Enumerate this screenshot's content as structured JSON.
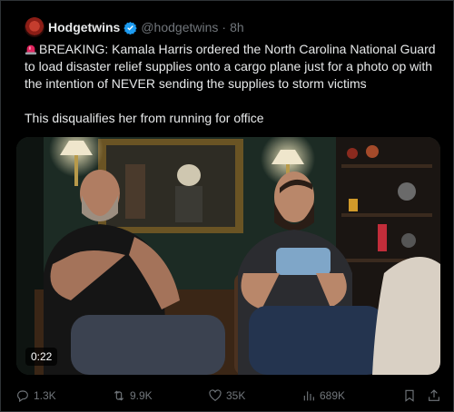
{
  "post": {
    "author_name": "Hodgetwins",
    "author_handle": "@hodgetwins",
    "separator": "·",
    "time": "8h",
    "text_line1": "BREAKING: Kamala Harris ordered the North Carolina National Guard to load disaster relief supplies onto a cargo plane just for a photo op with the intention of NEVER sending the supplies to storm victims",
    "text_line2": "This disqualifies her from running for office",
    "video_duration": "0:22"
  },
  "actions": {
    "replies": "1.3K",
    "reposts": "9.9K",
    "likes": "35K",
    "views": "689K"
  },
  "icons": {
    "avatar": "profile-avatar",
    "verified": "verified-badge-icon",
    "siren": "siren-emoji-icon",
    "reply": "reply-icon",
    "repost": "repost-icon",
    "like": "heart-icon",
    "views": "views-bar-icon",
    "bookmark": "bookmark-icon",
    "share": "share-icon"
  },
  "colors": {
    "background": "#000000",
    "text": "#e7e9ea",
    "muted": "#71767b",
    "verified": "#1d9bf0"
  }
}
